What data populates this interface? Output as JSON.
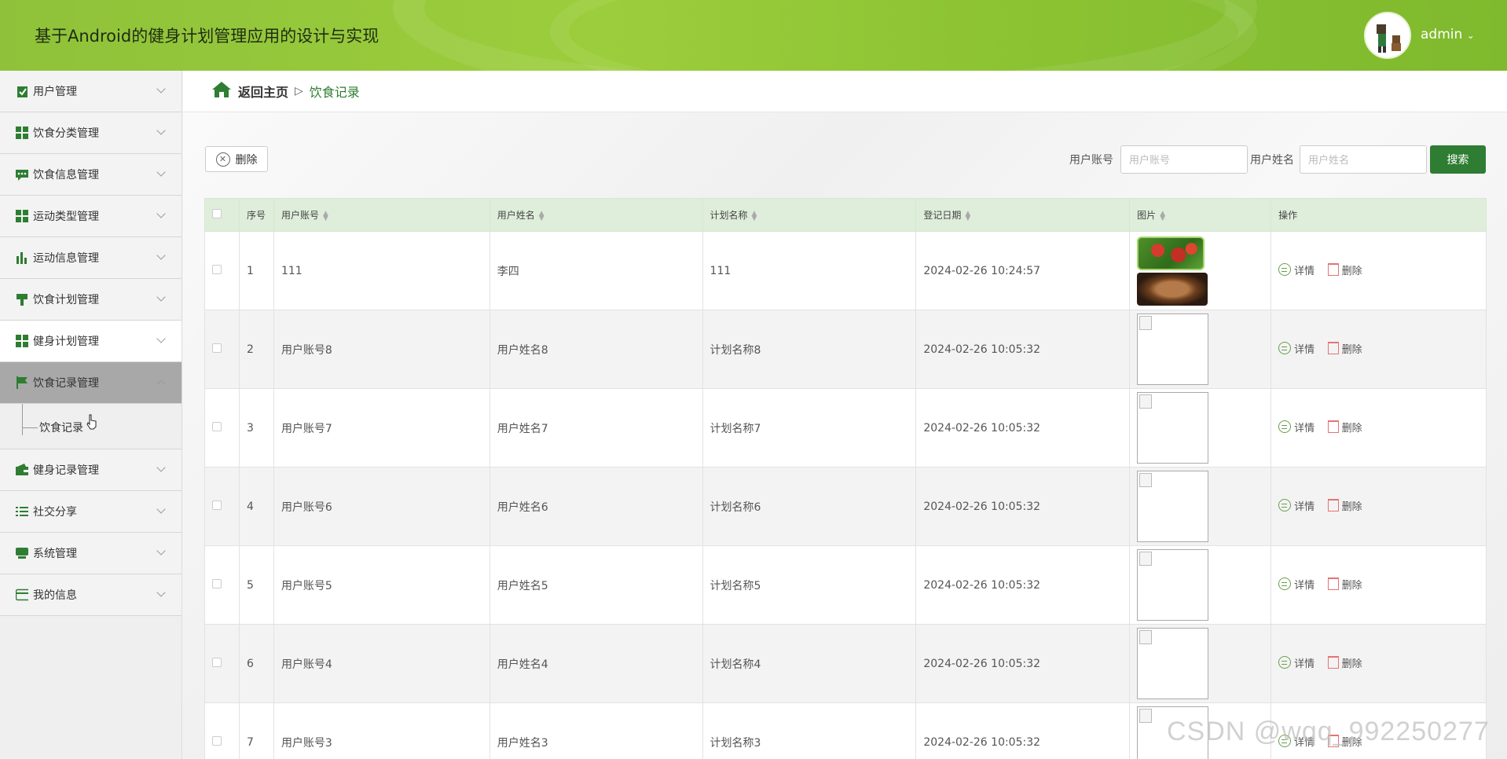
{
  "header": {
    "title": "基于Android的健身计划管理应用的设计与实现",
    "user": "admin",
    "bg_color": "#8fc23a"
  },
  "sidebar": {
    "items": [
      {
        "label": "用户管理",
        "icon": "clipboard-check-icon"
      },
      {
        "label": "饮食分类管理",
        "icon": "grid-icon"
      },
      {
        "label": "饮食信息管理",
        "icon": "chat-icon"
      },
      {
        "label": "运动类型管理",
        "icon": "grid-icon"
      },
      {
        "label": "运动信息管理",
        "icon": "bar-chart-icon"
      },
      {
        "label": "饮食计划管理",
        "icon": "paint-roller-icon"
      },
      {
        "label": "健身计划管理",
        "icon": "grid-icon"
      },
      {
        "label": "饮食记录管理",
        "icon": "flag-icon"
      },
      {
        "label": "健身记录管理",
        "icon": "wallet-icon"
      },
      {
        "label": "社交分享",
        "icon": "list-icon"
      },
      {
        "label": "系统管理",
        "icon": "monitor-icon"
      },
      {
        "label": "我的信息",
        "icon": "card-icon"
      }
    ],
    "submenu": {
      "label": "饮食记录"
    }
  },
  "breadcrumb": {
    "home": "返回主页",
    "separator": "▷",
    "current": "饮食记录"
  },
  "toolbar": {
    "delete_label": "删除",
    "account_label": "用户账号",
    "account_placeholder": "用户账号",
    "name_label": "用户姓名",
    "name_placeholder": "用户姓名",
    "search_label": "搜索",
    "accent_color": "#2e7d32"
  },
  "table": {
    "headers": [
      "序号",
      "用户账号",
      "用户姓名",
      "计划名称",
      "登记日期",
      "图片",
      "操作"
    ],
    "rows": [
      {
        "no": "1",
        "account": "111",
        "name": "李四",
        "plan": "111",
        "date": "2024-02-26 10:24:57",
        "image": "food-photos"
      },
      {
        "no": "2",
        "account": "用户账号8",
        "name": "用户姓名8",
        "plan": "计划名称8",
        "date": "2024-02-26 10:05:32",
        "image": "broken"
      },
      {
        "no": "3",
        "account": "用户账号7",
        "name": "用户姓名7",
        "plan": "计划名称7",
        "date": "2024-02-26 10:05:32",
        "image": "broken"
      },
      {
        "no": "4",
        "account": "用户账号6",
        "name": "用户姓名6",
        "plan": "计划名称6",
        "date": "2024-02-26 10:05:32",
        "image": "broken"
      },
      {
        "no": "5",
        "account": "用户账号5",
        "name": "用户姓名5",
        "plan": "计划名称5",
        "date": "2024-02-26 10:05:32",
        "image": "broken"
      },
      {
        "no": "6",
        "account": "用户账号4",
        "name": "用户姓名4",
        "plan": "计划名称4",
        "date": "2024-02-26 10:05:32",
        "image": "broken"
      },
      {
        "no": "7",
        "account": "用户账号3",
        "name": "用户姓名3",
        "plan": "计划名称3",
        "date": "2024-02-26 10:05:32",
        "image": "broken"
      }
    ],
    "action_detail": "详情",
    "action_delete": "删除"
  },
  "watermark": "CSDN @wqq_992250277"
}
